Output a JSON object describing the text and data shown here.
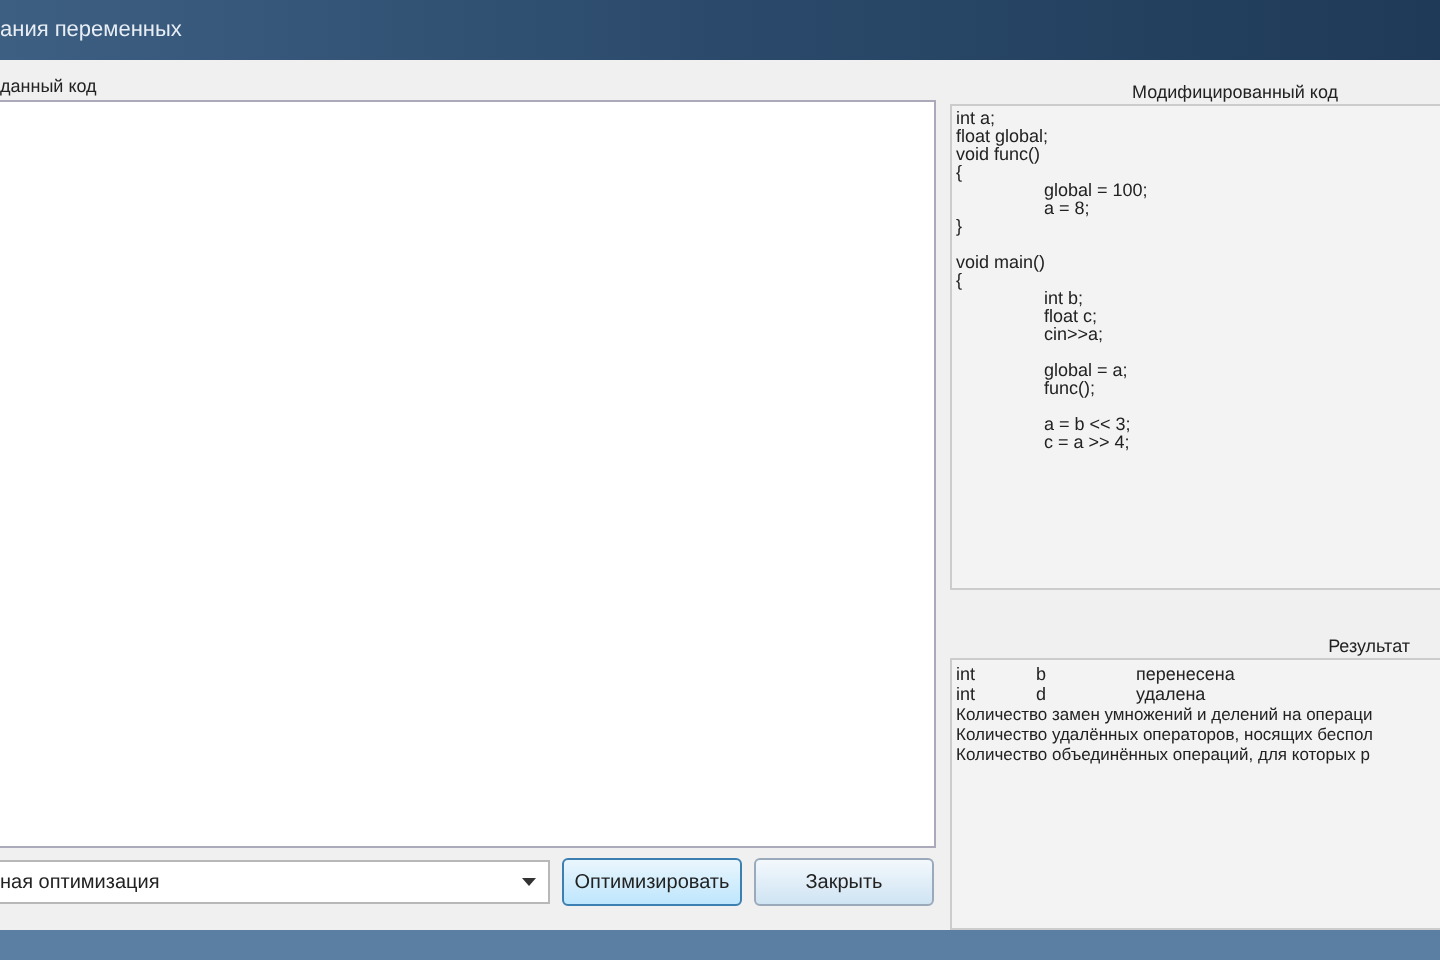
{
  "window": {
    "title": "ания переменных"
  },
  "source": {
    "label": "данный код"
  },
  "modified": {
    "label": "Модифицированный код",
    "lines": [
      {
        "text": "int a;",
        "indent": false,
        "gap_before": false
      },
      {
        "text": "float global;",
        "indent": false,
        "gap_before": false
      },
      {
        "text": "void func()",
        "indent": false,
        "gap_before": false
      },
      {
        "text": "{",
        "indent": false,
        "gap_before": false
      },
      {
        "text": "global = 100;",
        "indent": true,
        "gap_before": false
      },
      {
        "text": "a = 8;",
        "indent": true,
        "gap_before": false
      },
      {
        "text": "}",
        "indent": false,
        "gap_before": false
      },
      {
        "text": "void main()",
        "indent": false,
        "gap_before": true
      },
      {
        "text": "{",
        "indent": false,
        "gap_before": false
      },
      {
        "text": "int b;",
        "indent": true,
        "gap_before": false
      },
      {
        "text": "float c;",
        "indent": true,
        "gap_before": false
      },
      {
        "text": "cin>>a;",
        "indent": true,
        "gap_before": false
      },
      {
        "text": "global = a;",
        "indent": true,
        "gap_before": true
      },
      {
        "text": "func();",
        "indent": true,
        "gap_before": false
      },
      {
        "text": "a = b << 3;",
        "indent": true,
        "gap_before": true
      },
      {
        "text": "c = a >> 4;",
        "indent": true,
        "gap_before": false
      }
    ]
  },
  "result": {
    "label": "Результат",
    "rows": [
      {
        "kind": "variable",
        "type": "int",
        "name": "b",
        "action": "перенесена"
      },
      {
        "kind": "variable",
        "type": "int",
        "name": "d",
        "action": "удалена"
      },
      {
        "kind": "note",
        "text": "Количество замен умножений и делений на операци"
      },
      {
        "kind": "note",
        "text": "Количество удалённых операторов, носящих беспол"
      },
      {
        "kind": "note",
        "text": "Количество объединённых операций, для которых р"
      }
    ]
  },
  "mode_select": {
    "value": "ная оптимизация"
  },
  "buttons": [
    {
      "label": "Оптимизировать",
      "selected": true
    },
    {
      "label": "Закрыть",
      "selected": false
    }
  ]
}
